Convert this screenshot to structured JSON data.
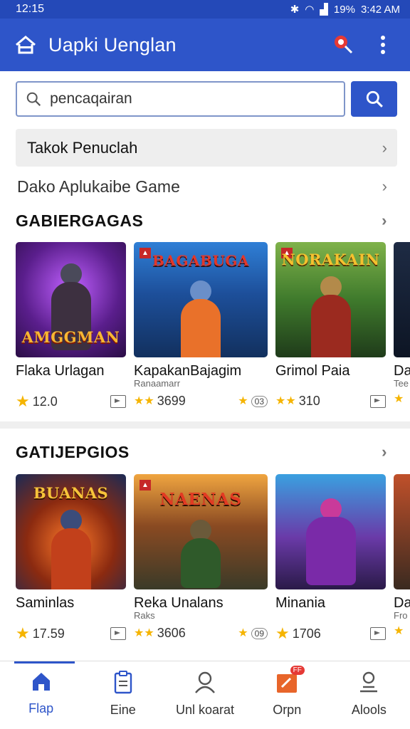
{
  "status": {
    "time": "12:15",
    "right": "19% ▮ 3:42 AM",
    "battery": "19%",
    "clock": "3:42 AM"
  },
  "appbar": {
    "title": "Uapki Uenglan"
  },
  "search": {
    "placeholder": "pencaqairan",
    "value": "pencaqairan"
  },
  "rows": {
    "card": "Takok Penuclah",
    "plain": "Dako Aplukaibe Game"
  },
  "section1": {
    "title": "GABIERGAGAS",
    "items": [
      {
        "art": "AMGGMAN",
        "title": "Flaka Urlagan",
        "subtitle": "",
        "rating": "12.0",
        "pill": ""
      },
      {
        "art": "BAGABUGA",
        "title": "KapakanBajagim",
        "subtitle": "Ranaamarr",
        "rating": "3699",
        "pill": "03"
      },
      {
        "art": "NORAKAIN",
        "title": "Grimol Paia",
        "subtitle": "",
        "rating": "310",
        "pill": ""
      },
      {
        "art": "",
        "title": "Da",
        "subtitle": "Tee",
        "rating": "",
        "pill": ""
      }
    ]
  },
  "section2": {
    "title": "GATIJEPGIOS",
    "items": [
      {
        "art": "BUANAS",
        "title": "Saminlas",
        "subtitle": "",
        "rating": "17.59",
        "pill": ""
      },
      {
        "art": "NAENAS",
        "title": "Reka Unalans",
        "subtitle": "Raks",
        "rating": "3606",
        "pill": "09"
      },
      {
        "art": "",
        "title": "Minania",
        "subtitle": "",
        "rating": "1706",
        "pill": ""
      },
      {
        "art": "",
        "title": "Da",
        "subtitle": "Fro",
        "rating": "",
        "pill": ""
      }
    ]
  },
  "nav": [
    {
      "label": "Flap",
      "icon": "home-icon"
    },
    {
      "label": "Eine",
      "icon": "clipboard-icon"
    },
    {
      "label": "Unl koarat",
      "icon": "profile-icon"
    },
    {
      "label": "Orpn",
      "icon": "tag-icon",
      "badge": "FF"
    },
    {
      "label": "Alools",
      "icon": "apps-icon"
    }
  ],
  "colors": {
    "primary": "#2e55c9",
    "statusbar": "#2449b8",
    "star": "#f5b400"
  }
}
